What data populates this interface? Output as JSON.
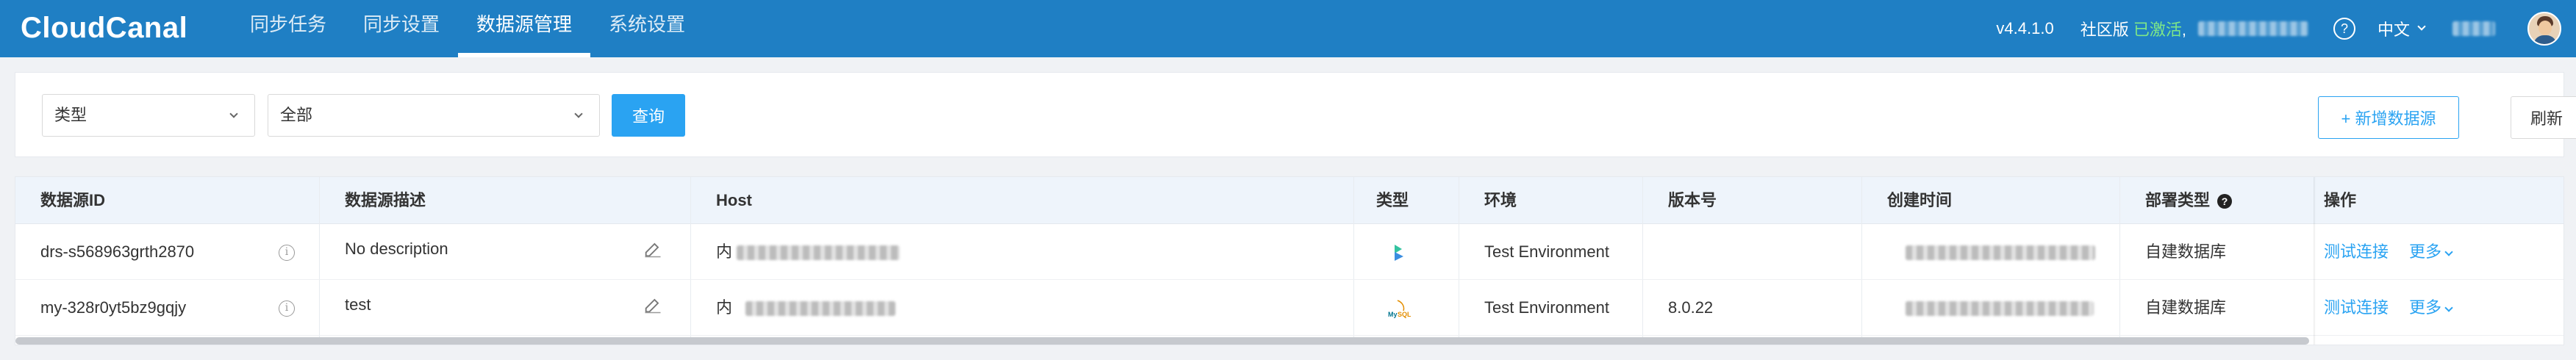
{
  "header": {
    "logo": "CloudCanal",
    "nav": [
      {
        "label": "同步任务",
        "active": false
      },
      {
        "label": "同步设置",
        "active": false
      },
      {
        "label": "数据源管理",
        "active": true
      },
      {
        "label": "系统设置",
        "active": false
      }
    ],
    "version": "v4.4.1.0",
    "edition": "社区版",
    "activated": "已激活",
    "separator": ",",
    "help": "?",
    "language": "中文",
    "colors": {
      "bar": "#1f7fc4",
      "activated": "#7ee787"
    }
  },
  "filters": {
    "type_select": "类型",
    "scope_select": "全部",
    "query_button": "查询",
    "add_button": "+ 新增数据源",
    "refresh_button": "刷新"
  },
  "table": {
    "columns": [
      "数据源ID",
      "数据源描述",
      "Host",
      "类型",
      "环境",
      "版本号",
      "创建时间",
      "部署类型",
      "操作"
    ],
    "deploy_help": "?",
    "rows": [
      {
        "id": "drs-s568963grth2870",
        "description": "No description",
        "host_prefix": "内",
        "type_icon": "doris-icon",
        "env": "Test Environment",
        "version": "",
        "deploy": "自建数据库",
        "action": "测试连接",
        "more": "更多"
      },
      {
        "id": "my-328r0yt5bz9gqjy",
        "description": "test",
        "host_prefix": "内",
        "type_icon": "mysql-icon",
        "env": "Test Environment",
        "version": "8.0.22",
        "deploy": "自建数据库",
        "action": "测试连接",
        "more": "更多"
      }
    ]
  }
}
